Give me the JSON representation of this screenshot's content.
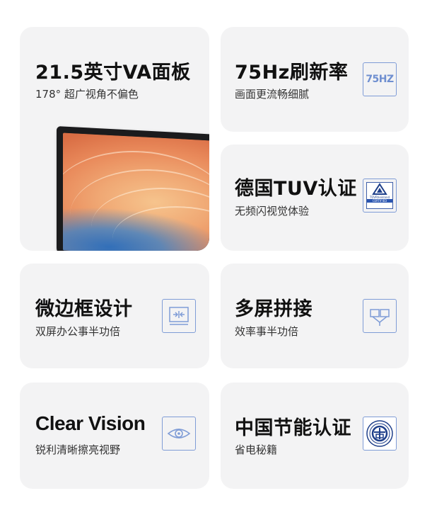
{
  "cards": [
    {
      "title": "21.5英寸VA面板",
      "subtitle": "178°  超广视角不偏色"
    },
    {
      "title": "75Hz刷新率",
      "subtitle": "画面更流畅细腻",
      "icon": "refresh-rate-icon",
      "icon_text": "75HZ"
    },
    {
      "title": "德国TUV认证",
      "subtitle": "无频闪视觉体验",
      "icon": "tuv-certified-icon",
      "icon_text_1": "TÜVRheinland",
      "icon_text_2": "CERTIFIED"
    },
    {
      "title": "微边框设计",
      "subtitle": "双屏办公事半功倍",
      "icon": "narrow-bezel-icon"
    },
    {
      "title": "多屏拼接",
      "subtitle": "效率事半功倍",
      "icon": "multi-screen-icon"
    },
    {
      "title": "Clear Vision",
      "subtitle": "锐利清晰擦亮视野",
      "icon": "eye-icon"
    },
    {
      "title": "中国节能认证",
      "subtitle": "省电秘籍",
      "icon": "energy-saving-seal-icon"
    }
  ],
  "colors": {
    "card_bg": "#f3f3f4",
    "icon_accent": "#7f9cd6",
    "title_text": "#111111"
  }
}
